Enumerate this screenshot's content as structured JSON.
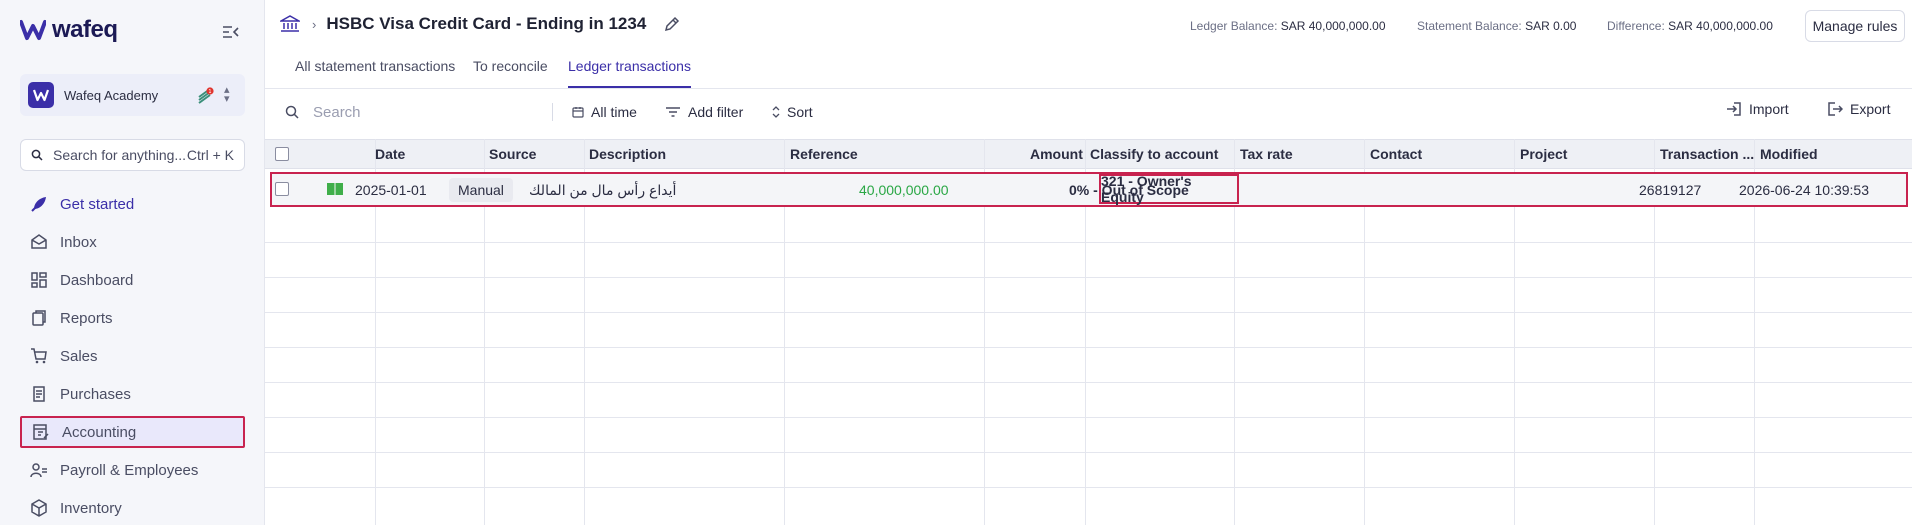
{
  "app": {
    "logo_text": "wafeq"
  },
  "org": {
    "name": "Wafeq Academy",
    "notification_badge": "1"
  },
  "sidebar_search": {
    "placeholder": "Search for anything...",
    "shortcut": "Ctrl + K"
  },
  "nav": {
    "items": [
      {
        "label": "Get started",
        "icon": "rocket-icon"
      },
      {
        "label": "Inbox",
        "icon": "inbox-icon"
      },
      {
        "label": "Dashboard",
        "icon": "dashboard-icon"
      },
      {
        "label": "Reports",
        "icon": "reports-icon"
      },
      {
        "label": "Sales",
        "icon": "cart-icon"
      },
      {
        "label": "Purchases",
        "icon": "receipt-icon"
      },
      {
        "label": "Accounting",
        "icon": "accounting-icon"
      },
      {
        "label": "Payroll & Employees",
        "icon": "people-icon"
      },
      {
        "label": "Inventory",
        "icon": "box-icon"
      }
    ]
  },
  "header": {
    "account_title": "HSBC Visa Credit Card - Ending in 1234",
    "ledger_balance_label": "Ledger Balance:",
    "ledger_balance_value": "SAR 40,000,000.00",
    "statement_balance_label": "Statement Balance:",
    "statement_balance_value": "SAR 0.00",
    "difference_label": "Difference:",
    "difference_value": "SAR 40,000,000.00",
    "manage_rules": "Manage rules"
  },
  "tabs": [
    {
      "label": "All statement transactions"
    },
    {
      "label": "To reconcile"
    },
    {
      "label": "Ledger transactions",
      "active": true
    }
  ],
  "toolbar": {
    "search_placeholder": "Search",
    "all_time": "All time",
    "add_filter": "Add filter",
    "sort": "Sort",
    "import": "Import",
    "export": "Export"
  },
  "table": {
    "columns": [
      "Date",
      "Source",
      "Description",
      "Reference",
      "Amount",
      "Classify to account",
      "Tax rate",
      "Contact",
      "Project",
      "Transaction ...",
      "Modified"
    ],
    "rows": [
      {
        "date": "2025-01-01",
        "source": "Manual",
        "description": "أيداع رأس مال من المالك",
        "reference": "",
        "amount": "40,000,000.00",
        "classify": "321 - Owner's Equity",
        "tax_rate": "0% - Out of Scope",
        "contact": "",
        "project": "",
        "transaction": "26819127",
        "modified": "2026-06-24 10:39:53"
      }
    ]
  },
  "colors": {
    "accent": "#3b2fa8",
    "highlight": "#c8234f",
    "amount_positive": "#2aa745"
  }
}
